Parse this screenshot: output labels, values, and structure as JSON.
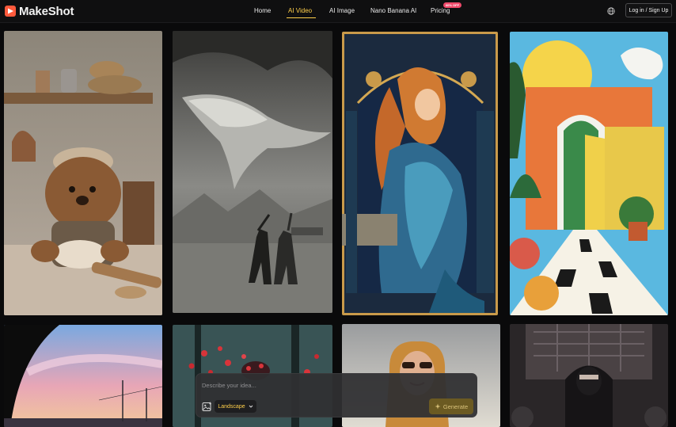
{
  "brand": {
    "name": "MakeShot",
    "accent": "#ff5a3c"
  },
  "nav": {
    "items": [
      {
        "label": "Home",
        "active": false
      },
      {
        "label": "AI Video",
        "active": true
      },
      {
        "label": "AI Image",
        "active": false
      },
      {
        "label": "Nano Banana AI",
        "active": false
      },
      {
        "label": "Pricing",
        "active": false
      }
    ],
    "pricing_badge": "60% OFF",
    "active_color": "#ffcf4a"
  },
  "header_actions": {
    "language_icon": "globe-icon",
    "login_label": "Log in / Sign Up"
  },
  "gallery": {
    "tiles": [
      {
        "id": "teddy-bear-baker"
      },
      {
        "id": "flying-whale"
      },
      {
        "id": "art-nouveau-woman"
      },
      {
        "id": "surreal-doorway"
      },
      {
        "id": "sunset-road"
      },
      {
        "id": "red-blossom-forest"
      },
      {
        "id": "woman-sunglasses"
      },
      {
        "id": "ninja-warrior"
      }
    ]
  },
  "prompt": {
    "placeholder": "Describe your idea...",
    "aspect_label": "Landscape",
    "generate_label": "Generate",
    "image_icon": "image-upload-icon"
  }
}
